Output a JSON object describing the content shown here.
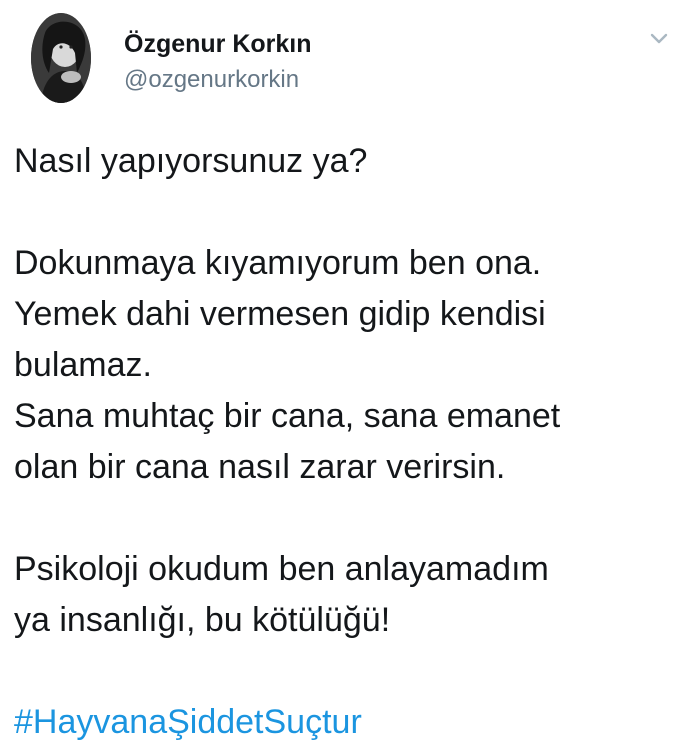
{
  "author": {
    "display_name": "Özgenur Korkın",
    "handle": "@ozgenurkorkin",
    "avatar_icon": "profile-photo"
  },
  "menu": {
    "icon": "chevron-down-icon"
  },
  "tweet": {
    "paragraphs": [
      [
        "Nasıl yapıyorsunuz ya?"
      ],
      [
        "Dokunmaya kıyamıyorum ben ona.",
        "Yemek dahi vermesen gidip kendisi",
        "bulamaz.",
        "Sana muhtaç bir cana, sana emanet",
        "olan bir cana nasıl zarar verirsin."
      ],
      [
        "Psikoloji okudum ben anlayamadım",
        "ya insanlığı, bu kötülüğü!"
      ]
    ],
    "hashtag": "#HayvanaŞiddetSuçtur"
  },
  "colors": {
    "text": "#14171a",
    "handle": "#657786",
    "hashtag": "#1b95e0",
    "chevron": "#aab8c2"
  }
}
